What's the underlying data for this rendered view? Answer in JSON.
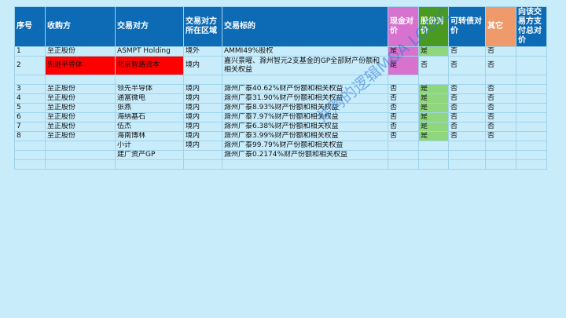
{
  "headers": {
    "seq": "序号",
    "acquirer": "收购方",
    "counterparty": "交易对方",
    "region": "交易对方所在区域",
    "target": "交易标的",
    "cash": "现金对价",
    "shares": "股份对价",
    "convertible": "可转债对价",
    "other": "其它",
    "paid_to": "向该交易方支付总对价"
  },
  "rows": [
    {
      "seq": "1",
      "acquirer": "至正股份",
      "counterparty": "ASMPT Holding",
      "region": "境外",
      "target": "AMMI49%股权",
      "cash": "是",
      "shares": "是",
      "convertible": "否",
      "other": "否"
    },
    {
      "seq": "2",
      "acquirer": "先进半导体",
      "counterparty": "北京智路资本",
      "region": "境内",
      "target": "嘉兴景曜、滁州智元2支基金的GP全部财产份额和相关权益",
      "cash": "是",
      "shares": "否",
      "convertible": "否",
      "other": "否"
    },
    {
      "seq": "",
      "acquirer": "",
      "counterparty": "",
      "region": "",
      "target": "",
      "cash": "",
      "shares": "",
      "convertible": "",
      "other": ""
    },
    {
      "seq": "3",
      "acquirer": "至正股份",
      "counterparty": "领先半导体",
      "region": "境内",
      "target": "滁州广泰40.62%财产份额和相关权益",
      "cash": "否",
      "shares": "是",
      "convertible": "否",
      "other": "否"
    },
    {
      "seq": "4",
      "acquirer": "至正股份",
      "counterparty": "通富微电",
      "region": "境内",
      "target": "滁州广泰31.90%财产份额和相关权益",
      "cash": "否",
      "shares": "是",
      "convertible": "否",
      "other": "否"
    },
    {
      "seq": "5",
      "acquirer": "至正股份",
      "counterparty": "张燕",
      "region": "境内",
      "target": "滁州广泰8.93%财产份额和相关权益",
      "cash": "否",
      "shares": "是",
      "convertible": "否",
      "other": "否"
    },
    {
      "seq": "6",
      "acquirer": "至正股份",
      "counterparty": "海纳基石",
      "region": "境内",
      "target": "滁州广泰7.97%财产份额和相关权益",
      "cash": "否",
      "shares": "是",
      "convertible": "否",
      "other": "否"
    },
    {
      "seq": "7",
      "acquirer": "至正股份",
      "counterparty": "伍杰",
      "region": "境内",
      "target": "滁州广泰6.38%财产份额和相关权益",
      "cash": "否",
      "shares": "是",
      "convertible": "否",
      "other": "否"
    },
    {
      "seq": "8",
      "acquirer": "至正股份",
      "counterparty": "海南博林",
      "region": "境内",
      "target": "滁州广泰3.99%财产份额和相关权益",
      "cash": "否",
      "shares": "是",
      "convertible": "否",
      "other": "否"
    },
    {
      "seq": "",
      "acquirer": "",
      "counterparty": "小计",
      "region": "境内",
      "target": "滁州广泰99.79%财产份额和相关权益",
      "cash": "",
      "shares": "",
      "convertible": "",
      "other": ""
    },
    {
      "seq": "",
      "acquirer": "",
      "counterparty": "建广资产GP",
      "region": "",
      "target": "滁州广泰0.2174%财产份额和相关权益",
      "cash": "",
      "shares": "",
      "convertible": "",
      "other": ""
    },
    {
      "seq": "",
      "acquirer": "",
      "counterparty": "",
      "region": "",
      "target": "",
      "cash": "",
      "shares": "",
      "convertible": "",
      "other": ""
    }
  ],
  "watermark": "并购的逻辑M&A LOGIC",
  "colors": {
    "header_blue": "#0d6ab4",
    "cash_pink": "#d772cf",
    "shares_green": "#4a9a22",
    "other_orange": "#ef9a6a",
    "highlight_red": "#ff0000",
    "shares_cell_green": "#8fd67d",
    "background": "#c9ecfb"
  }
}
